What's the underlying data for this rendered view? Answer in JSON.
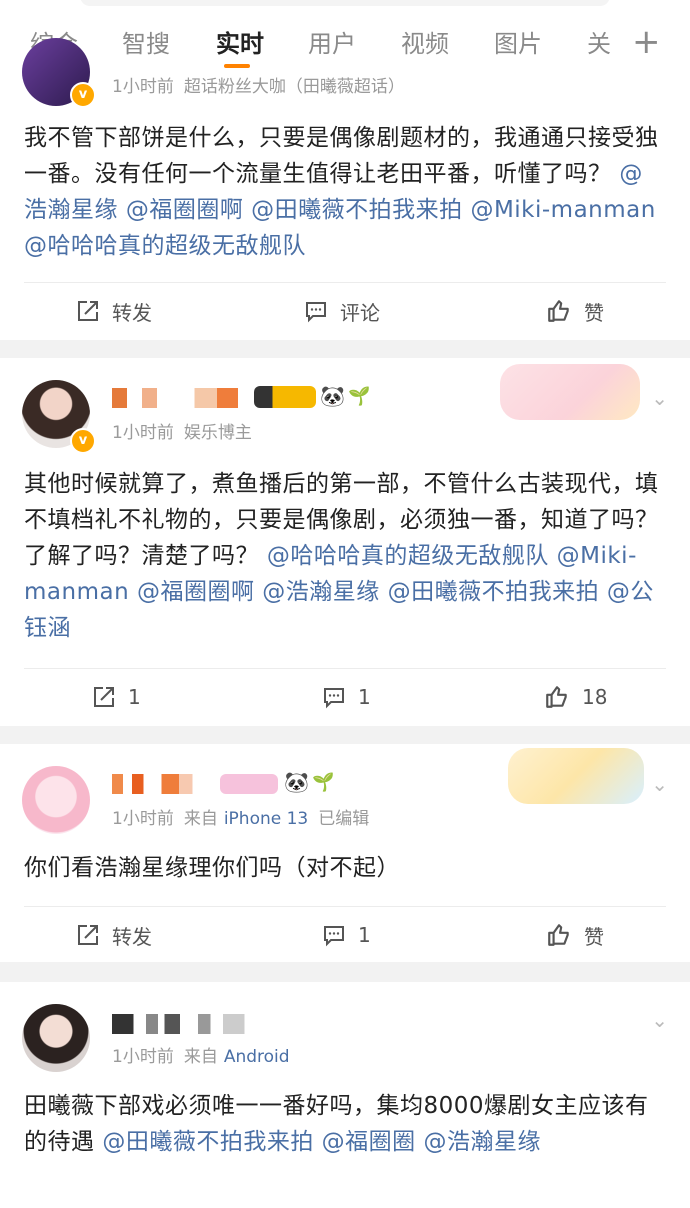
{
  "tabs": [
    {
      "label": "综合",
      "active": false
    },
    {
      "label": "智搜",
      "active": false
    },
    {
      "label": "实时",
      "active": true
    },
    {
      "label": "用户",
      "active": false
    },
    {
      "label": "视频",
      "active": false
    },
    {
      "label": "图片",
      "active": false
    },
    {
      "label": "关",
      "active": false
    }
  ],
  "accent_color": "#ff8200",
  "link_color": "#4a6fa5",
  "posts": [
    {
      "time": "1小时前",
      "source": "超话粉丝大咖（田曦薇超话）",
      "text_plain": "我不管下部饼是什么，只要是偶像剧题材的，我通通只接受独一番。没有任何一个流量生值得让老田平番，听懂了吗？",
      "mentions": [
        "@浩瀚星缘",
        "@福圈圈啊",
        "@田曦薇不拍我来拍",
        "@Miki-manman",
        "@哈哈哈真的超级无敌舰队"
      ],
      "repost": "转发",
      "comment": "评论",
      "like": "赞"
    },
    {
      "time": "1小时前",
      "source": "娱乐博主",
      "text_plain": "其他时候就算了，煮鱼播后的第一部，不管什么古装现代，填不填档礼不礼物的，只要是偶像剧，必须独一番，知道了吗？了解了吗？清楚了吗？",
      "mentions": [
        "@哈哈哈真的超级无敌舰队",
        "@Miki-manman",
        "@福圈圈啊",
        "@浩瀚星缘",
        "@田曦薇不拍我来拍",
        "@公钰涵"
      ],
      "repost": "1",
      "comment": "1",
      "like": "18"
    },
    {
      "time": "1小时前",
      "source": "来自",
      "device": "iPhone 13",
      "edited": "已编辑",
      "text_plain": "你们看浩瀚星缘理你们吗（对不起）",
      "repost": "转发",
      "comment": "1",
      "like": "赞"
    },
    {
      "time": "1小时前",
      "source": "来自",
      "device": "Android",
      "text_plain": "田曦薇下部戏必须唯一一番好吗，集均8000爆剧女主应该有的待遇",
      "mentions": [
        "@田曦薇不拍我来拍",
        "@福圈圈",
        "@浩瀚星缘"
      ]
    }
  ]
}
